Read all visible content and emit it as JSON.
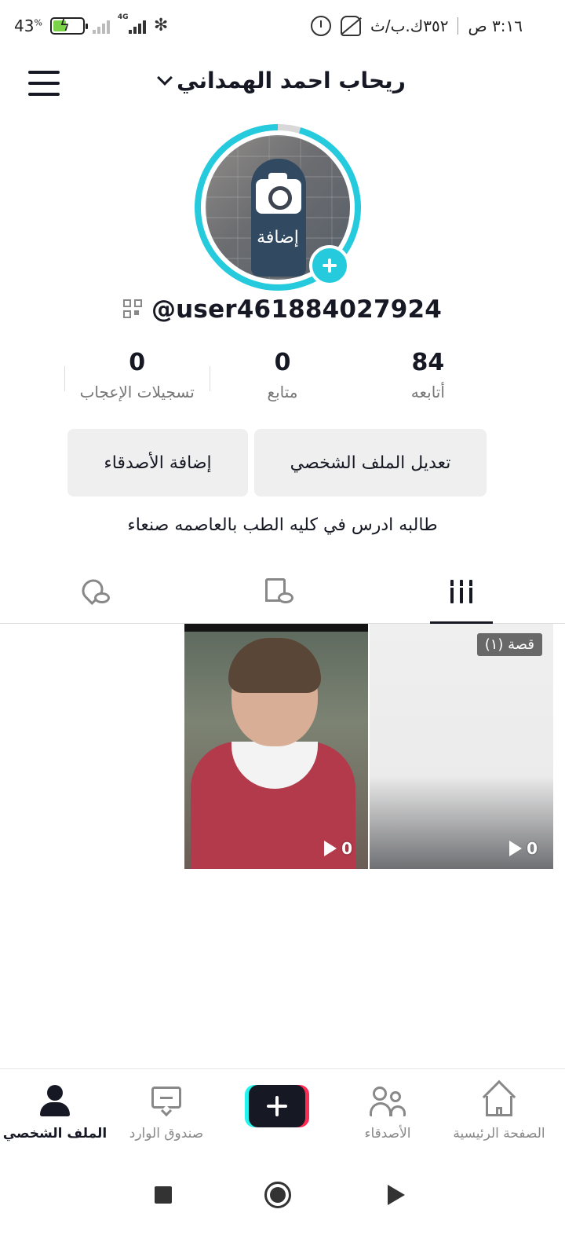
{
  "status_bar": {
    "battery_percent": "43",
    "battery_percent_sign": "%",
    "network_type": "4G",
    "data_rate": "٣٥٢ك.ب/ث",
    "time": "٣:١٦ ص"
  },
  "header": {
    "profile_name": "ريحاب احمد الهمداني"
  },
  "avatar": {
    "add_label": "إضافة"
  },
  "profile": {
    "username": "@user461884027924",
    "bio": "طالبه ادرس في كليه الطب بالعاصمه صنعاء"
  },
  "stats": [
    {
      "value": "84",
      "label": "أتابعه"
    },
    {
      "value": "0",
      "label": "متابع"
    },
    {
      "value": "0",
      "label": "تسجيلات الإعجاب"
    }
  ],
  "actions": {
    "edit_profile": "تعديل الملف الشخصي",
    "add_friends": "إضافة الأصدقاء"
  },
  "tabs": [
    {
      "icon": "grid-icon",
      "active": true
    },
    {
      "icon": "bookmark-hidden-icon",
      "active": false
    },
    {
      "icon": "heart-hidden-icon",
      "active": false
    }
  ],
  "videos": [
    {
      "badge": "قصة (١)",
      "plays": "0"
    },
    {
      "plays": "0"
    }
  ],
  "bottom_nav": {
    "home": "الصفحة الرئيسية",
    "friends": "الأصدقاء",
    "inbox": "صندوق الوارد",
    "profile": "الملف الشخصي"
  },
  "colors": {
    "accent_cyan": "#25cadc",
    "brand_red": "#fe2c55",
    "brand_cyan": "#25f4ee",
    "text_primary": "#161823"
  }
}
